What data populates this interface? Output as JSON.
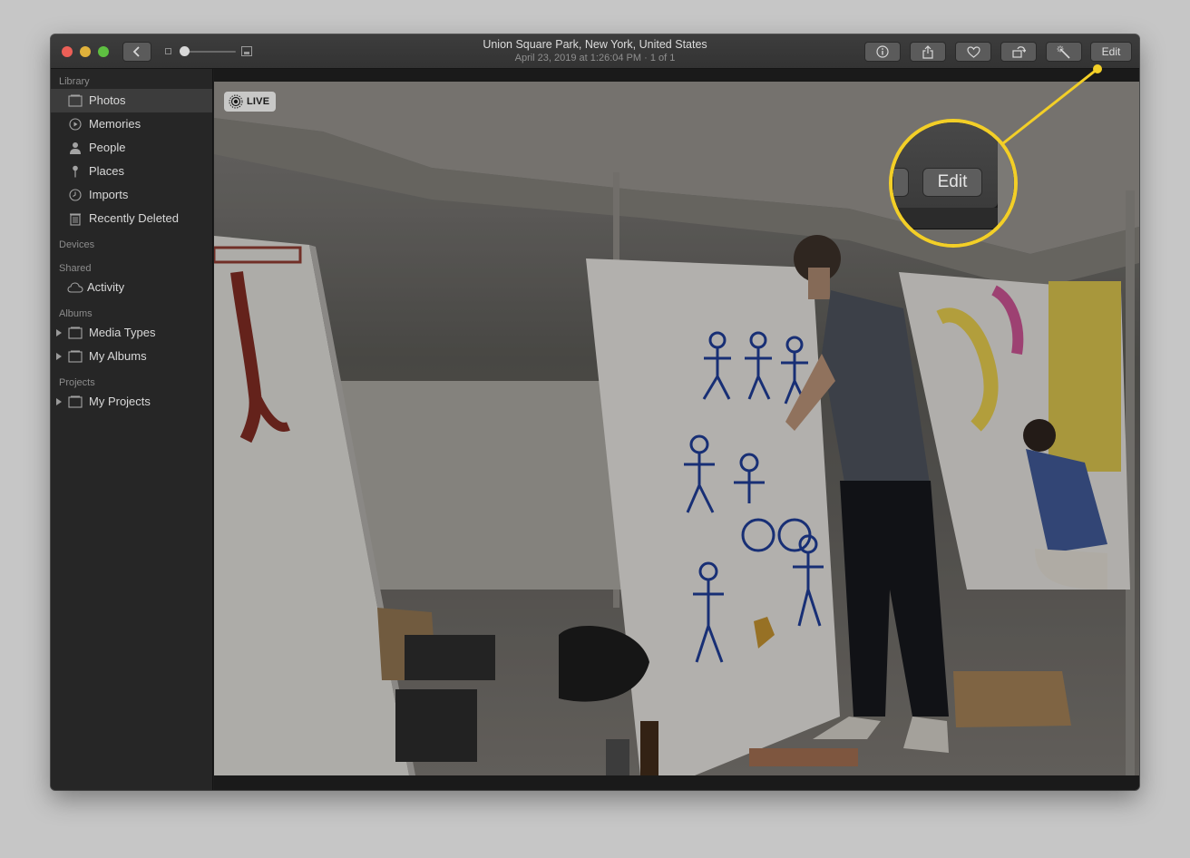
{
  "window": {
    "title": "Union Square Park, New York, United States",
    "subtitle": "April 23, 2019 at 1:26:04 PM  ·  1 of 1"
  },
  "toolbar": {
    "edit_label": "Edit",
    "buttons": [
      "back-icon",
      "info-icon",
      "share-icon",
      "heart-icon",
      "rotate-icon",
      "magic-wand-icon"
    ]
  },
  "sidebar": {
    "library_header": "Library",
    "library_items": [
      {
        "label": "Photos",
        "icon": "photos-icon"
      },
      {
        "label": "Memories",
        "icon": "memories-icon"
      },
      {
        "label": "People",
        "icon": "person-icon"
      },
      {
        "label": "Places",
        "icon": "pin-icon"
      },
      {
        "label": "Imports",
        "icon": "clock-icon"
      },
      {
        "label": "Recently Deleted",
        "icon": "trash-icon"
      }
    ],
    "devices_header": "Devices",
    "shared_header": "Shared",
    "shared_items": [
      {
        "label": "Activity",
        "icon": "cloud-icon"
      }
    ],
    "albums_header": "Albums",
    "albums_items": [
      {
        "label": "Media Types",
        "icon": "folder-icon"
      },
      {
        "label": "My Albums",
        "icon": "folder-icon"
      }
    ],
    "projects_header": "Projects",
    "projects_items": [
      {
        "label": "My Projects",
        "icon": "folder-icon"
      }
    ]
  },
  "photo": {
    "live_label": "LIVE"
  },
  "callout": {
    "label": "Edit",
    "color": "#f3cf27"
  }
}
